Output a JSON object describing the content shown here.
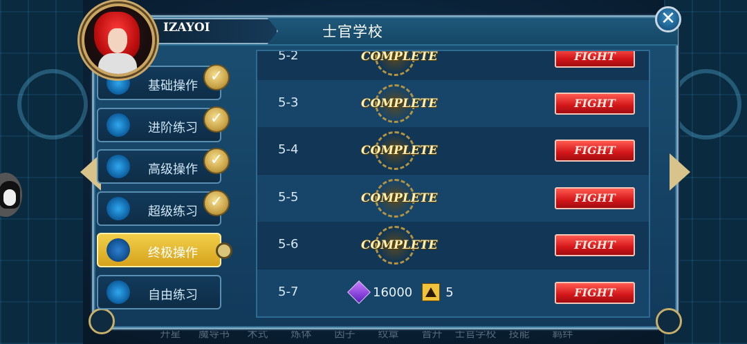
{
  "window": {
    "title": "士官学校"
  },
  "player": {
    "name": "IZAYOI"
  },
  "bottom_nav": [
    "升星",
    "魔导书",
    "术式",
    "炼体",
    "因子",
    "纹章",
    "晋升",
    "士官学校",
    "技能",
    "羁绊"
  ],
  "menu": [
    {
      "label": "基础操作",
      "icon": "basic-ops-icon",
      "completed": true,
      "active": false
    },
    {
      "label": "进阶练习",
      "icon": "advanced-practice-icon",
      "completed": true,
      "active": false
    },
    {
      "label": "高级操作",
      "icon": "expert-ops-icon",
      "completed": true,
      "active": false
    },
    {
      "label": "超级练习",
      "icon": "super-practice-icon",
      "completed": true,
      "active": false
    },
    {
      "label": "终极操作",
      "icon": "ultimate-ops-icon",
      "completed": false,
      "active": true
    },
    {
      "label": "自由练习",
      "icon": "free-practice-icon",
      "completed": false,
      "active": false
    }
  ],
  "levels": [
    {
      "id": "5-2",
      "status": "COMPLETE",
      "action": "FIGHT"
    },
    {
      "id": "5-3",
      "status": "COMPLETE",
      "action": "FIGHT"
    },
    {
      "id": "5-4",
      "status": "COMPLETE",
      "action": "FIGHT"
    },
    {
      "id": "5-5",
      "status": "COMPLETE",
      "action": "FIGHT"
    },
    {
      "id": "5-6",
      "status": "COMPLETE",
      "action": "FIGHT"
    },
    {
      "id": "5-7",
      "reward_gems": "16000",
      "reward_item": "5",
      "action": "FIGHT"
    }
  ],
  "icons": {
    "close": "close-icon",
    "prev": "arrow-left-icon",
    "next": "arrow-right-icon",
    "gem": "purple-gem-icon",
    "triangle": "triangle-token-icon",
    "check": "check-badge-icon"
  },
  "colors": {
    "panel": "#1a4f72",
    "active_menu": "#f2cf49",
    "fight_button": "#d3161a",
    "complete_text": "#fff1b6"
  }
}
